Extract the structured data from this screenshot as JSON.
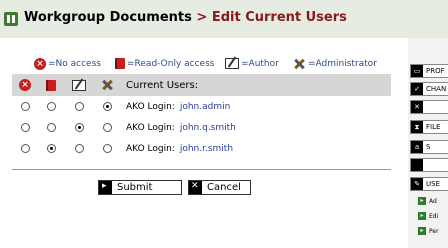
{
  "header": {
    "title_main": "Workgroup Documents",
    "title_sep": " > ",
    "title_sub": "Edit Current Users"
  },
  "legend": [
    {
      "icon": "no-access-icon",
      "label": "=No access"
    },
    {
      "icon": "read-only-icon",
      "label": "=Read-Only access"
    },
    {
      "icon": "author-icon",
      "label": "=Author"
    },
    {
      "icon": "administrator-icon",
      "label": "=Administrator"
    }
  ],
  "table": {
    "header_label": "Current Users:",
    "rows": [
      {
        "label": "AKO Login:",
        "user": "john.admin",
        "selected": 3
      },
      {
        "label": "AKO Login:",
        "user": "john.q.smith",
        "selected": 2
      },
      {
        "label": "AKO Login:",
        "user": "john.r.smith",
        "selected": 1
      }
    ]
  },
  "buttons": {
    "submit": "Submit",
    "cancel": "Cancel"
  },
  "sidebar": {
    "items": [
      {
        "label": "PROF",
        "icon": "profile-icon"
      },
      {
        "label": "CHAN",
        "icon": "check-icon"
      },
      {
        "label": "",
        "icon": "close-box-icon"
      },
      {
        "label": "FILE",
        "icon": "hourglass-icon"
      },
      {
        "label": "S",
        "icon": "text-icon"
      },
      {
        "label": "",
        "icon": "blank-icon"
      },
      {
        "label": "USE",
        "icon": "pen-icon"
      }
    ],
    "subitems": [
      {
        "label": "Ad",
        "icon": "green-arrow-icon"
      },
      {
        "label": "Edi",
        "icon": "green-arrow-icon"
      },
      {
        "label": "Per",
        "icon": "green-arrow-icon"
      }
    ]
  },
  "colors": {
    "header_bg": "#e6ece2",
    "title_sub": "#8a1a1a",
    "link": "#2a3f9a",
    "table_header_bg": "#d6d6d6"
  }
}
